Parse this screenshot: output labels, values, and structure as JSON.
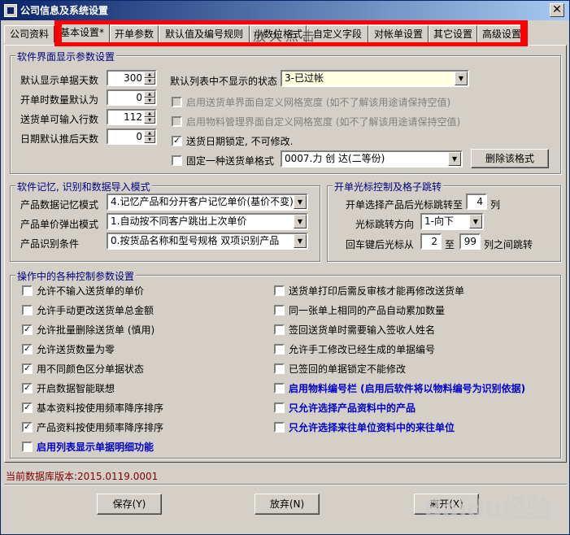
{
  "window": {
    "title": "公司信息及系统设置",
    "close_label": "✕"
  },
  "tabs": [
    "公司资料",
    "基本设置*",
    "开单参数",
    "默认值及编号规则",
    "小数位格式",
    "自定义字段",
    "对帐单设置",
    "其它设置",
    "高级设置"
  ],
  "watermark_top": "放大点击",
  "g1": {
    "title": "软件界面显示参数设置",
    "rows": [
      {
        "label": "默认显示单据天数",
        "value": "300"
      },
      {
        "label": "开单时数量默认为",
        "value": "0"
      },
      {
        "label": "送货单可输入行数",
        "value": "112"
      },
      {
        "label": "日期默认推后天数",
        "value": "0"
      }
    ],
    "hidden_status_label": "默认列表中不显示的状态",
    "hidden_status_value": "3-已过帐",
    "opt1": "启用送货单界面自定义网格宽度 (如不了解该用途请保持空值)",
    "opt2": "启用物料管理界面自定义网格宽度 (如不了解该用途请保持空值)",
    "opt3": "送货日期锁定, 不可修改.",
    "opt4": "固定一种送货单格式",
    "format_value": "0007.力 创 达(二等份)",
    "delete_format": "删除该格式"
  },
  "g2": {
    "title": "软件记忆, 识别和数据导入模式",
    "rows": [
      {
        "label": "产品数据记忆模式",
        "value": "4.记忆产品和分开客户记忆单价(基价不变)"
      },
      {
        "label": "产品单价弹出模式",
        "value": "1.自动按不同客户跳出上次单价"
      },
      {
        "label": "产品识别条件",
        "value": "0.按货品名称和型号规格 双项识别产品"
      }
    ]
  },
  "g3": {
    "title": "开单光标控制及格子跳转",
    "jump_label": "开单选择产品后光标跳转至",
    "jump_value": "4",
    "jump_unit": "列",
    "dir_label": "光标跳转方向",
    "dir_value": "1-向下",
    "enter_label": "回车键后光标从",
    "enter_from": "2",
    "enter_to_label": "至",
    "enter_to": "99",
    "enter_suffix": "列之间跳转"
  },
  "g4": {
    "title": "操作中的各种控制参数设置",
    "left": [
      {
        "label": "允许不输入送货单的单价",
        "checked": ""
      },
      {
        "label": "允许手动更改送货单总金额",
        "checked": ""
      },
      {
        "label": "允许批量删除送货单 (慎用)",
        "checked": "✓"
      },
      {
        "label": "允许送货数量为零",
        "checked": "✓"
      },
      {
        "label": "用不同颜色区分单据状态",
        "checked": "✓"
      },
      {
        "label": "开启数据智能联想",
        "checked": "✓"
      },
      {
        "label": "基本资料按使用频率降序排序",
        "checked": "✓"
      },
      {
        "label": "产品资料按使用频率降序排序",
        "checked": "✓"
      },
      {
        "label": "启用列表显示单据明细功能",
        "checked": ""
      }
    ],
    "right": [
      {
        "label": "送货单打印后需反审核才能再修改送货单",
        "checked": ""
      },
      {
        "label": "同一张单上相同的产品自动累加数量",
        "checked": ""
      },
      {
        "label": "签回送货单时需要输入签收人姓名",
        "checked": ""
      },
      {
        "label": "允许手工修改已经生成的单据编号",
        "checked": ""
      },
      {
        "label": "已签回的单据锁定不能修改",
        "checked": ""
      },
      {
        "label": "启用物料编号栏 (启用后软件将以物料编号为识别依据)",
        "checked": ""
      },
      {
        "label": "只允许选择产品资料中的产品",
        "checked": ""
      },
      {
        "label": "只允许选择来往单位资料中的来往单位",
        "checked": ""
      }
    ]
  },
  "status": "当前数据库版本:2015.0119.0001",
  "buttons": {
    "save": "保存(Y)",
    "cancel": "放弃(N)",
    "exit": "离开(X)"
  },
  "watermark_bottom": "Baidu经验"
}
